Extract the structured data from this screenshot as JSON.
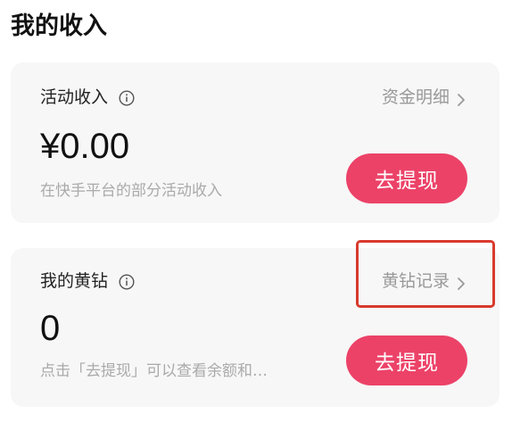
{
  "page": {
    "title": "我的收入"
  },
  "income_card": {
    "label": "活动收入",
    "link_label": "资金明细",
    "amount": "¥0.00",
    "description": "在快手平台的部分活动收入",
    "button_label": "去提现"
  },
  "diamond_card": {
    "label": "我的黄钻",
    "link_label": "黄钻记录",
    "amount": "0",
    "description": "点击「去提现」可以查看余额和…",
    "button_label": "去提现"
  },
  "colors": {
    "accent": "#ec4268",
    "highlight": "#d83a2e",
    "card_background": "#f7f7f7",
    "muted_text": "#999999"
  },
  "icons": {
    "info": "info-circle-icon",
    "chevron": "chevron-right-icon"
  }
}
